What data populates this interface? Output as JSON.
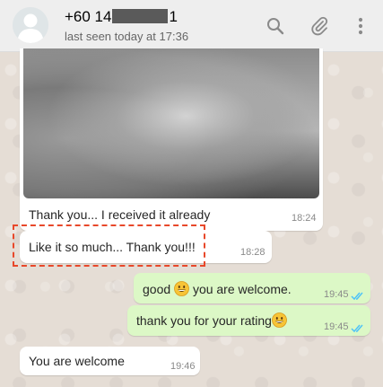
{
  "header": {
    "contact_prefix": "+60 14",
    "contact_suffix": "1",
    "status": "last seen today at 17:36",
    "icons": [
      "search-icon",
      "attach-icon",
      "menu-icon"
    ]
  },
  "messages": [
    {
      "direction": "in",
      "type": "image",
      "caption": "Thank you... I received it already",
      "time": "18:24"
    },
    {
      "direction": "in",
      "text": "Like it so much... Thank you!!!",
      "time": "18:28",
      "highlighted": true
    },
    {
      "direction": "out",
      "text_before": "good",
      "emoji": "grinning-face",
      "text_after": "you are welcome.",
      "time": "19:45",
      "ticks": "double-blue"
    },
    {
      "direction": "out",
      "text_before": "thank you for your rating",
      "emoji": "grinning-face",
      "time": "19:45",
      "ticks": "double-blue"
    },
    {
      "direction": "in",
      "text": "You are welcome",
      "time": "19:46"
    }
  ],
  "colors": {
    "header_bg": "#eeeeee",
    "wallpaper": "#e5ddd5",
    "incoming_bubble": "#ffffff",
    "outgoing_bubble": "#dcf8c6",
    "read_ticks": "#4fc3f7",
    "highlight_border": "#e8482a"
  }
}
